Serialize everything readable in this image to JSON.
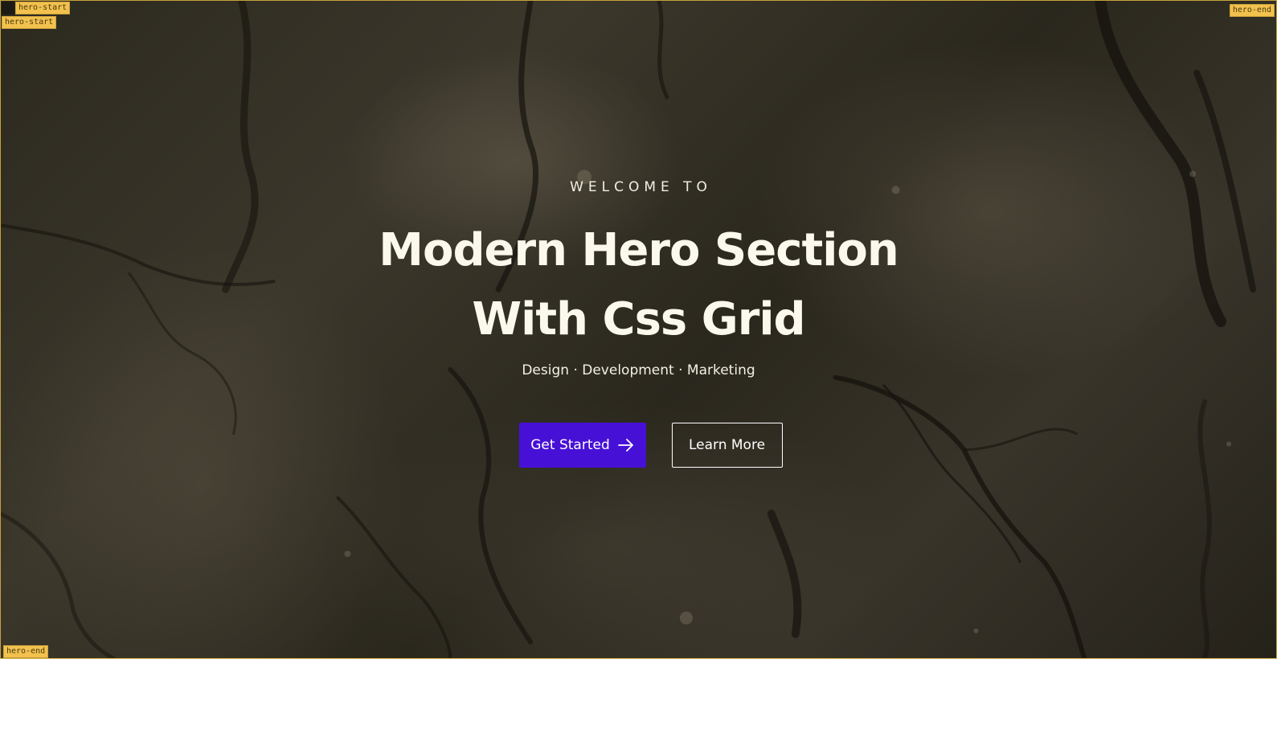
{
  "hero": {
    "eyebrow": "WELCOME TO",
    "title_line1": "Modern Hero Section",
    "title_line2": "With Css Grid",
    "subtitle": "Design · Development · Marketing",
    "primary_button_label": "Get Started",
    "primary_button_icon": "arrow-right-icon",
    "secondary_button_label": "Learn More"
  },
  "grid_labels": {
    "row_start_top": "hero-start",
    "col_start_left": "hero-start",
    "col_end_right": "hero-end",
    "row_end_bottom": "hero-end"
  },
  "colors": {
    "primary_button": "#4710d6",
    "label_background": "#f2c14e",
    "hero_border": "#c9a23a"
  }
}
